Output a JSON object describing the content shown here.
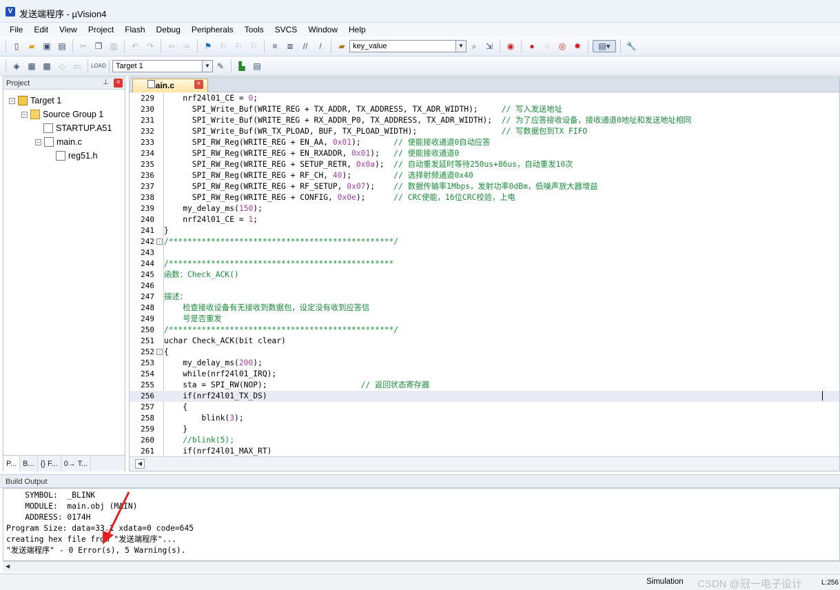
{
  "window": {
    "title": "发送端程序 - µVision4",
    "app_icon": "uvision-icon"
  },
  "menu": [
    "File",
    "Edit",
    "View",
    "Project",
    "Flash",
    "Debug",
    "Peripherals",
    "Tools",
    "SVCS",
    "Window",
    "Help"
  ],
  "toolbar1": {
    "find_combo_value": "key_value"
  },
  "toolbar2": {
    "target_combo_value": "Target 1"
  },
  "project": {
    "header": "Project",
    "tree": [
      {
        "label": "Target 1",
        "level": 0,
        "type": "target"
      },
      {
        "label": "Source Group 1",
        "level": 1,
        "type": "folder"
      },
      {
        "label": "STARTUP.A51",
        "level": 2,
        "type": "file"
      },
      {
        "label": "main.c",
        "level": 2,
        "type": "file"
      },
      {
        "label": "reg51.h",
        "level": 3,
        "type": "file"
      }
    ],
    "tabs": [
      "P...",
      "B...",
      "{} F...",
      "0→ T..."
    ]
  },
  "editor": {
    "tab_label": "main.c",
    "current_line": 256,
    "lines": [
      {
        "n": "229",
        "text": "    nrf24l01_CE = 0;",
        "cmt": ""
      },
      {
        "n": "230",
        "text": "      SPI_Write_Buf(WRITE_REG + TX_ADDR, TX_ADDRESS, TX_ADR_WIDTH);     ",
        "cmt": "// 写入发送地址"
      },
      {
        "n": "231",
        "text": "      SPI_Write_Buf(WRITE_REG + RX_ADDR_P0, TX_ADDRESS, TX_ADR_WIDTH);  ",
        "cmt": "// 为了应答接收设备，接收通道0地址和发送地址相同"
      },
      {
        "n": "232",
        "text": "      SPI_Write_Buf(WR_TX_PLOAD, BUF, TX_PLOAD_WIDTH);                  ",
        "cmt": "// 写数据包到TX FIFO"
      },
      {
        "n": "233",
        "text": "      SPI_RW_Reg(WRITE_REG + EN_AA, 0x01);       ",
        "cmt": "// 使能接收通道0自动应答"
      },
      {
        "n": "234",
        "text": "      SPI_RW_Reg(WRITE_REG + EN_RXADDR, 0x01);   ",
        "cmt": "// 使能接收通道0"
      },
      {
        "n": "235",
        "text": "      SPI_RW_Reg(WRITE_REG + SETUP_RETR, 0x0a);  ",
        "cmt": "// 自动重发延时等待250us+86us，自动重发10次"
      },
      {
        "n": "236",
        "text": "      SPI_RW_Reg(WRITE_REG + RF_CH, 40);         ",
        "cmt": "// 选择射频通道0x40"
      },
      {
        "n": "237",
        "text": "      SPI_RW_Reg(WRITE_REG + RF_SETUP, 0x07);    ",
        "cmt": "// 数据传输率1Mbps，发射功率0dBm，低噪声放大器增益"
      },
      {
        "n": "238",
        "text": "      SPI_RW_Reg(WRITE_REG + CONFIG, 0x0e);      ",
        "cmt": "// CRC使能，16位CRC校验，上电"
      },
      {
        "n": "239",
        "text": "    my_delay_ms(150);",
        "cmt": ""
      },
      {
        "n": "240",
        "text": "    nrf24l01_CE = 1;",
        "cmt": ""
      },
      {
        "n": "241",
        "text": "}",
        "cmt": ""
      },
      {
        "n": "242",
        "text": "",
        "cmt": "/************************************************/",
        "fold": "-"
      },
      {
        "n": "243",
        "text": "",
        "cmt": ""
      },
      {
        "n": "244",
        "text": "",
        "cmt": "/************************************************"
      },
      {
        "n": "245",
        "text": "",
        "cmt": "函数：Check_ACK()"
      },
      {
        "n": "246",
        "text": "",
        "cmt": ""
      },
      {
        "n": "247",
        "text": "",
        "cmt": "描述："
      },
      {
        "n": "248",
        "text": "",
        "cmt": "    检查接收设备有无接收到数据包，设定没有收到应答信"
      },
      {
        "n": "249",
        "text": "",
        "cmt": "    号是否重发"
      },
      {
        "n": "250",
        "text": "",
        "cmt": "/************************************************/"
      },
      {
        "n": "251",
        "text": "uchar Check_ACK(bit clear)",
        "cmt": ""
      },
      {
        "n": "252",
        "text": "{",
        "cmt": "",
        "fold": "-"
      },
      {
        "n": "253",
        "text": "    my_delay_ms(200);",
        "cmt": ""
      },
      {
        "n": "254",
        "text": "    while(nrf24l01_IRQ);",
        "cmt": ""
      },
      {
        "n": "255",
        "text": "    sta = SPI_RW(NOP);                    ",
        "cmt": "// 返回状态寄存器"
      },
      {
        "n": "256",
        "text": "    if(nrf24l01_TX_DS)",
        "cmt": ""
      },
      {
        "n": "257",
        "text": "    {",
        "cmt": ""
      },
      {
        "n": "258",
        "text": "        blink(3);",
        "cmt": ""
      },
      {
        "n": "259",
        "text": "    }",
        "cmt": ""
      },
      {
        "n": "260",
        "text": "    ",
        "cmt": "//blink(5);"
      },
      {
        "n": "261",
        "text": "    if(nrf24l01_MAX_RT)",
        "cmt": ""
      }
    ]
  },
  "build": {
    "header": "Build Output",
    "text": "    SYMBOL:  _BLINK\n    MODULE:  main.obj (MAIN)\n    ADDRESS: 0174H\nProgram Size: data=33.1 xdata=0 code=645\ncreating hex file from \"发送端程序\"...\n\"发送端程序\" - 0 Error(s), 5 Warning(s)."
  },
  "status": {
    "mode": "Simulation",
    "watermark": "CSDN @冠一电子设计",
    "position": "L:256"
  },
  "colors": {
    "comment": "#1b8a3a",
    "number": "#a43fa3",
    "current_line": "#e8eaf6",
    "annotation_arrow": "#e02020"
  }
}
